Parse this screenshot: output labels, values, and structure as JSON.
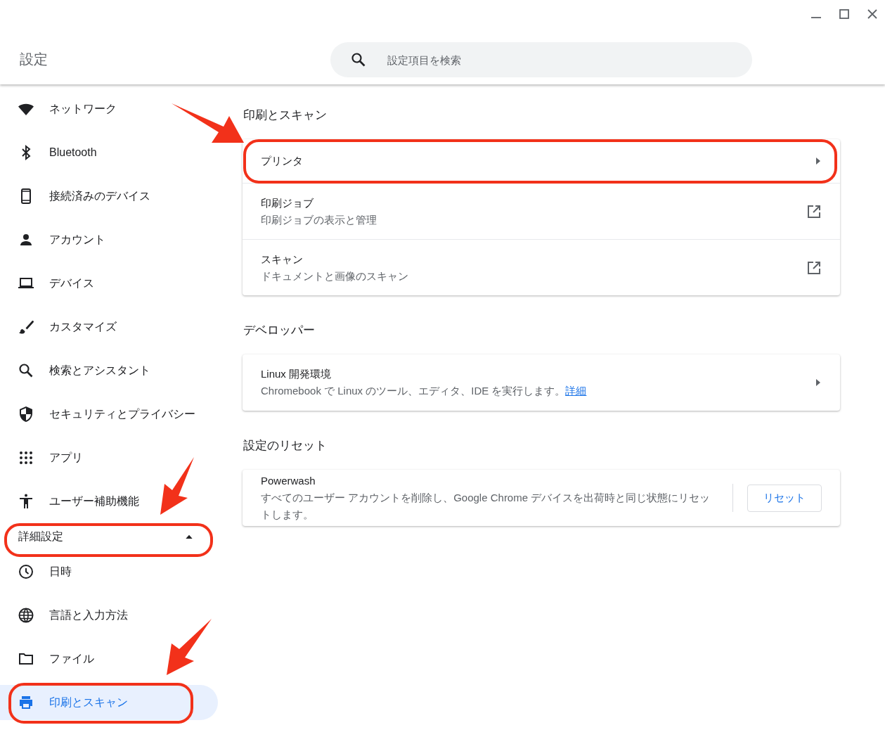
{
  "window": {
    "title": "設定"
  },
  "search": {
    "placeholder": "設定項目を検索"
  },
  "sidebar": {
    "items": [
      {
        "label": "ネットワーク",
        "selected": false
      },
      {
        "label": "Bluetooth",
        "selected": false
      },
      {
        "label": "接続済みのデバイス",
        "selected": false
      },
      {
        "label": "アカウント",
        "selected": false
      },
      {
        "label": "デバイス",
        "selected": false
      },
      {
        "label": "カスタマイズ",
        "selected": false
      },
      {
        "label": "検索とアシスタント",
        "selected": false
      },
      {
        "label": "セキュリティとプライバシー",
        "selected": false
      },
      {
        "label": "アプリ",
        "selected": false
      },
      {
        "label": "ユーザー補助機能",
        "selected": false
      }
    ],
    "advanced": {
      "label": "詳細設定",
      "expanded": true,
      "items": [
        {
          "label": "日時",
          "selected": false
        },
        {
          "label": "言語と入力方法",
          "selected": false
        },
        {
          "label": "ファイル",
          "selected": false
        },
        {
          "label": "印刷とスキャン",
          "selected": true
        }
      ]
    }
  },
  "sections": [
    {
      "title": "印刷とスキャン",
      "rows": [
        {
          "kind": "subpage",
          "title": "プリンタ"
        },
        {
          "kind": "external",
          "title": "印刷ジョブ",
          "description": "印刷ジョブの表示と管理"
        },
        {
          "kind": "external",
          "title": "スキャン",
          "description": "ドキュメントと画像のスキャン"
        }
      ]
    },
    {
      "title": "デベロッパー",
      "rows": [
        {
          "kind": "subpage",
          "title": "Linux 開発環境",
          "description": "Chromebook で Linux のツール、エディタ、IDE を実行します。",
          "link": "詳細"
        }
      ]
    },
    {
      "title": "設定のリセット",
      "rows": [
        {
          "kind": "action",
          "title": "Powerwash",
          "description": "すべてのユーザー アカウントを削除し、Google Chrome デバイスを出荷時と同じ状態にリセットします。",
          "button": "リセット"
        }
      ]
    }
  ]
}
